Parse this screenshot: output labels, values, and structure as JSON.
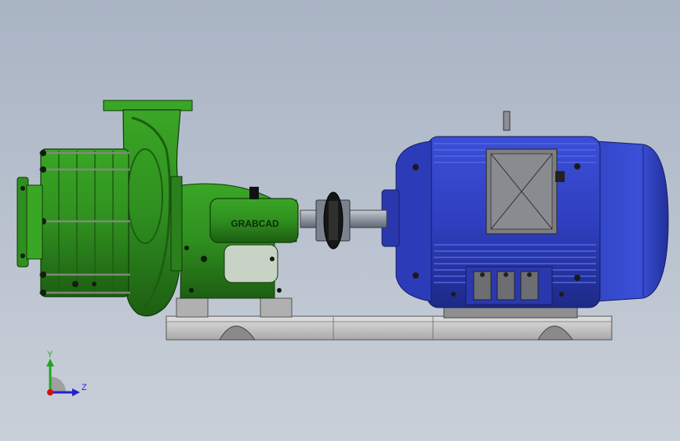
{
  "model": {
    "pump_logo_text": "GRABCAD"
  },
  "triad": {
    "y_label": "Y",
    "z_label": "Z"
  },
  "colors": {
    "background_top": "#a9b4c4",
    "background_bottom": "#c9d0d9",
    "pump_green": "#2f8f1f",
    "pump_green_dark": "#1d5e12",
    "motor_blue": "#2f3fc0",
    "motor_blue_dark": "#1d2a86",
    "base_grey": "#c8c8c8",
    "shaft_grey": "#9aa3ad",
    "triad_y": "#1fa61f",
    "triad_z": "#2222cc",
    "triad_origin": "#cc1111"
  },
  "icons": {
    "coordinate_triad": "triad-icon"
  }
}
